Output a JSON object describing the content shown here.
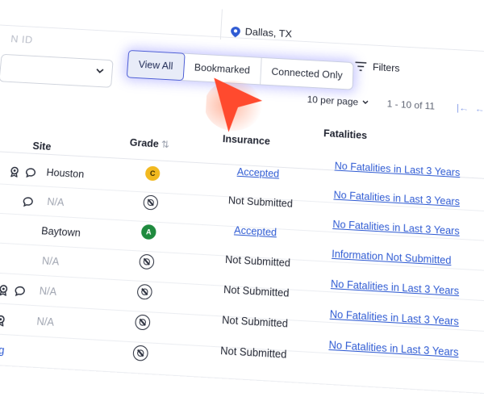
{
  "search": {
    "location": "Dallas, TX",
    "id_placeholder": "N ID"
  },
  "tabs": {
    "view_all": "View All",
    "bookmarked": "Bookmarked",
    "connected_only": "Connected Only"
  },
  "filters_label": "Filters",
  "pagination": {
    "per_page": "10 per page",
    "range": "1 - 10 of 11",
    "first": "|←",
    "prev": "←"
  },
  "columns": {
    "site": "Site",
    "grade": "Grade",
    "sort_icon": "⇅",
    "insurance": "Insurance",
    "fatalities": "Fatalities"
  },
  "rows": [
    {
      "site": "Houston",
      "site_na": false,
      "grade": "C",
      "insurance": "Accepted",
      "insurance_link": true,
      "fatalities": "No Fatalities in Last 3 Years",
      "award": true,
      "comment": true
    },
    {
      "site": "N/A",
      "site_na": true,
      "grade": "",
      "insurance": "Not Submitted",
      "insurance_link": false,
      "fatalities": "No Fatalities in Last 3 Years",
      "award": false,
      "comment": true
    },
    {
      "site": "Baytown",
      "site_na": false,
      "grade": "A",
      "insurance": "Accepted",
      "insurance_link": true,
      "fatalities": "No Fatalities in Last 3 Years",
      "award": false,
      "comment": false
    },
    {
      "site": "N/A",
      "site_na": true,
      "grade": "",
      "insurance": "Not Submitted",
      "insurance_link": false,
      "fatalities": "Information Not Submitted",
      "award": false,
      "comment": false
    },
    {
      "site": "N/A",
      "site_na": true,
      "grade": "",
      "insurance": "Not Submitted",
      "insurance_link": false,
      "fatalities": "No Fatalities in Last 3 Years",
      "award": true,
      "comment": true
    },
    {
      "site": "N/A",
      "site_na": true,
      "grade": "",
      "insurance": "Not Submitted",
      "insurance_link": false,
      "fatalities": "No Fatalities in Last 3 Years",
      "award": true,
      "comment": false
    },
    {
      "site": "",
      "site_na": false,
      "grade": "",
      "insurance": "Not Submitted",
      "insurance_link": false,
      "fatalities": "No Fatalities in Last 3 Years",
      "award": false,
      "comment": false
    }
  ],
  "left_link": "sting",
  "colors": {
    "accent": "#2f5bd3",
    "grade_c": "#f2b91f",
    "grade_a": "#1f8a3e",
    "cursor": "#ff4a2e"
  }
}
